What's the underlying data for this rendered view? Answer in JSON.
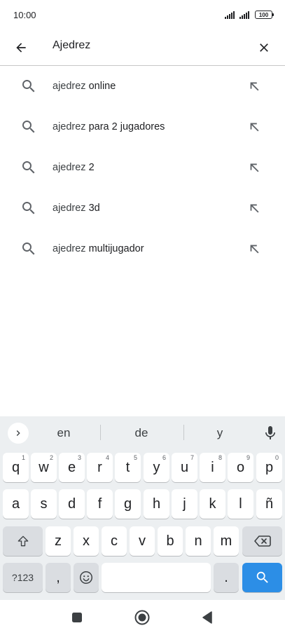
{
  "status_bar": {
    "time": "10:00",
    "battery": "100"
  },
  "search": {
    "query": "Ajedrez"
  },
  "suggestions": [
    {
      "prefix": "ajedrez",
      "rest": " online"
    },
    {
      "prefix": "ajedrez",
      "rest": " para 2 jugadores"
    },
    {
      "prefix": "ajedrez",
      "rest": " 2"
    },
    {
      "prefix": "ajedrez",
      "rest": " 3d"
    },
    {
      "prefix": "ajedrez",
      "rest": " multijugador"
    }
  ],
  "keyboard": {
    "word_suggestions": [
      "en",
      "de",
      "y"
    ],
    "row1": [
      {
        "key": "q",
        "hint": "1"
      },
      {
        "key": "w",
        "hint": "2"
      },
      {
        "key": "e",
        "hint": "3"
      },
      {
        "key": "r",
        "hint": "4"
      },
      {
        "key": "t",
        "hint": "5"
      },
      {
        "key": "y",
        "hint": "6"
      },
      {
        "key": "u",
        "hint": "7"
      },
      {
        "key": "i",
        "hint": "8"
      },
      {
        "key": "o",
        "hint": "9"
      },
      {
        "key": "p",
        "hint": "0"
      }
    ],
    "row2": [
      "a",
      "s",
      "d",
      "f",
      "g",
      "h",
      "j",
      "k",
      "l",
      "ñ"
    ],
    "row3": [
      "z",
      "x",
      "c",
      "v",
      "b",
      "n",
      "m"
    ],
    "symbols_label": "?123",
    "comma": ",",
    "period": "."
  },
  "colors": {
    "accent": "#2c8ee6",
    "keyboard_bg": "#eceff1"
  }
}
